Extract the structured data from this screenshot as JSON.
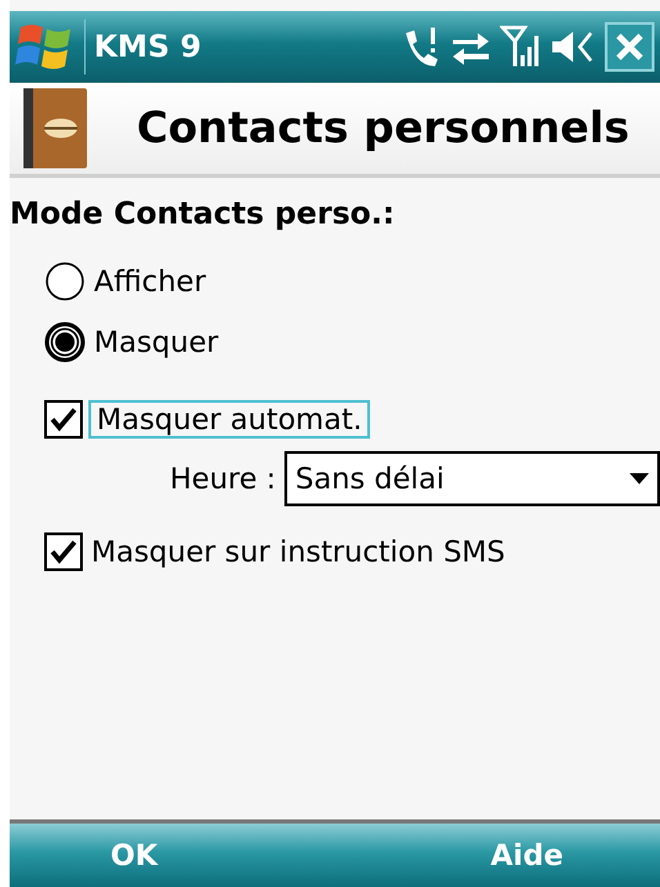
{
  "status_bar": {
    "title": "KMS 9"
  },
  "header": {
    "title": "Contacts personnels"
  },
  "section_label": "Mode Contacts perso.:",
  "mode_options": [
    {
      "label": "Afficher",
      "selected": false
    },
    {
      "label": "Masquer",
      "selected": true
    }
  ],
  "auto_hide": {
    "label": "Masquer automat.",
    "checked": true,
    "focused": true
  },
  "time_field": {
    "label": "Heure :",
    "value": "Sans délai"
  },
  "sms_hide": {
    "label": "Masquer sur instruction SMS",
    "checked": true
  },
  "softkeys": [
    "OK",
    "Aide"
  ]
}
